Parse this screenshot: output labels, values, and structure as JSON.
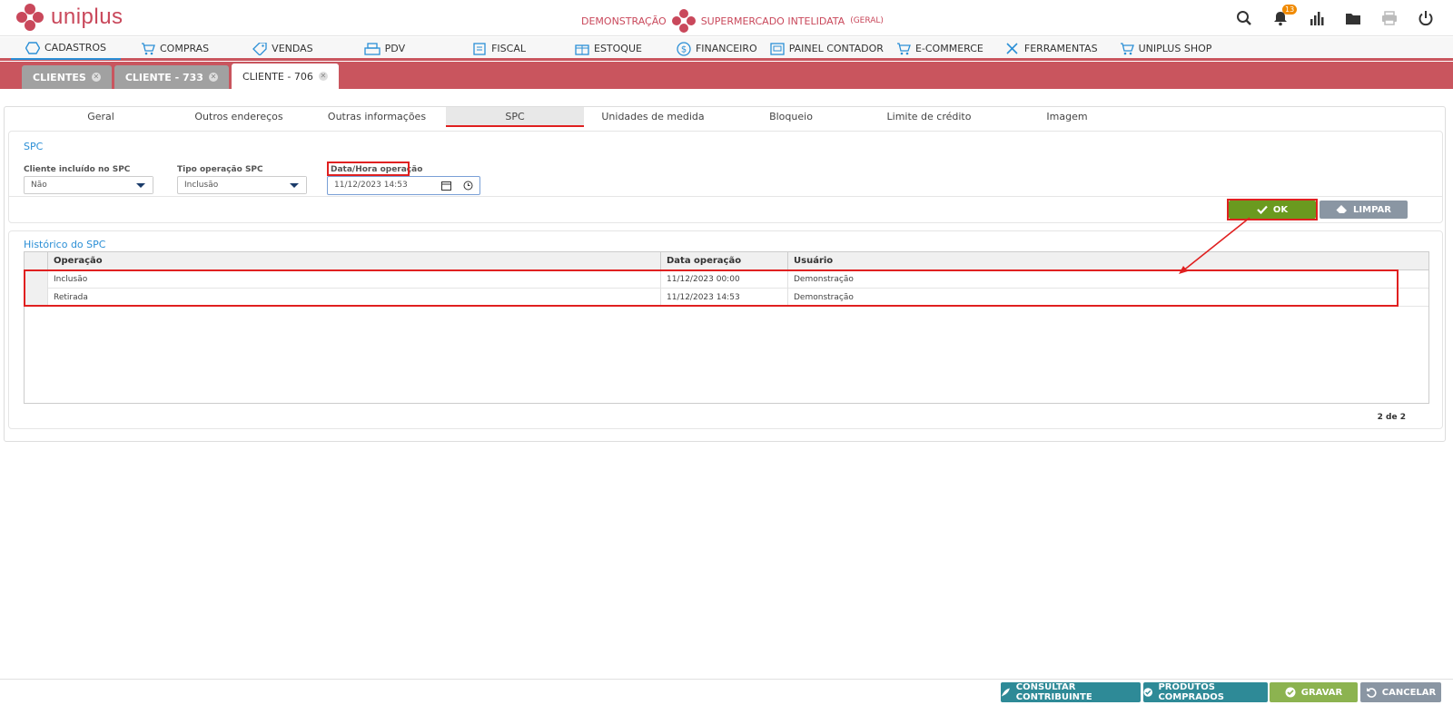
{
  "brand": {
    "name": "uniplus"
  },
  "header": {
    "user": "DEMONSTRAÇÃO",
    "company": "SUPERMERCADO INTELIDATA",
    "company_scope": "(GERAL)",
    "notification_count": "13"
  },
  "menu": {
    "items": [
      {
        "label": "CADASTROS",
        "icon": "hexagon-icon"
      },
      {
        "label": "COMPRAS",
        "icon": "cart-icon"
      },
      {
        "label": "VENDAS",
        "icon": "tag-icon"
      },
      {
        "label": "PDV",
        "icon": "register-icon"
      },
      {
        "label": "FISCAL",
        "icon": "document-icon"
      },
      {
        "label": "ESTOQUE",
        "icon": "box-icon"
      },
      {
        "label": "FINANCEIRO",
        "icon": "dollar-icon"
      },
      {
        "label": "PAINEL CONTADOR",
        "icon": "panel-icon"
      },
      {
        "label": "E-COMMERCE",
        "icon": "cart-icon"
      },
      {
        "label": "FERRAMENTAS",
        "icon": "tools-icon"
      },
      {
        "label": "UNIPLUS SHOP",
        "icon": "cart-icon"
      }
    ]
  },
  "doc_tabs": [
    {
      "label": "CLIENTES"
    },
    {
      "label": "CLIENTE - 733"
    },
    {
      "label": "CLIENTE - 706"
    }
  ],
  "subtabs": [
    {
      "label": "Geral"
    },
    {
      "label": "Outros endereços"
    },
    {
      "label": "Outras informações"
    },
    {
      "label": "SPC"
    },
    {
      "label": "Unidades de medida"
    },
    {
      "label": "Bloqueio"
    },
    {
      "label": "Limite de crédito"
    },
    {
      "label": "Imagem"
    }
  ],
  "spc": {
    "title": "SPC",
    "included_label": "Cliente incluído no SPC",
    "included_value": "Não",
    "operation_type_label": "Tipo operação SPC",
    "operation_type_value": "Inclusão",
    "datetime_label": "Data/Hora operação",
    "datetime_value": "11/12/2023 14:53",
    "ok_label": "OK",
    "clear_label": "LIMPAR"
  },
  "history": {
    "title": "Histórico do SPC",
    "columns": [
      "Operação",
      "Data operação",
      "Usuário"
    ],
    "rows": [
      {
        "operation": "Inclusão",
        "date": "11/12/2023 00:00",
        "user": "Demonstração"
      },
      {
        "operation": "Retirada",
        "date": "11/12/2023 14:53",
        "user": "Demonstração"
      }
    ],
    "pagination": "2 de 2"
  },
  "footer": {
    "consult": "CONSULTAR CONTRIBUINTE",
    "products": "PRODUTOS COMPRADOS",
    "save": "GRAVAR",
    "cancel": "CANCELAR"
  },
  "colors": {
    "brand": "#c9485b",
    "tabstrip": "#c9555e",
    "link_blue": "#2b8fd6",
    "ok_green": "#6a9a1f",
    "teal": "#2e8a97",
    "gray_btn": "#8a96a3",
    "highlight": "#e02020"
  }
}
